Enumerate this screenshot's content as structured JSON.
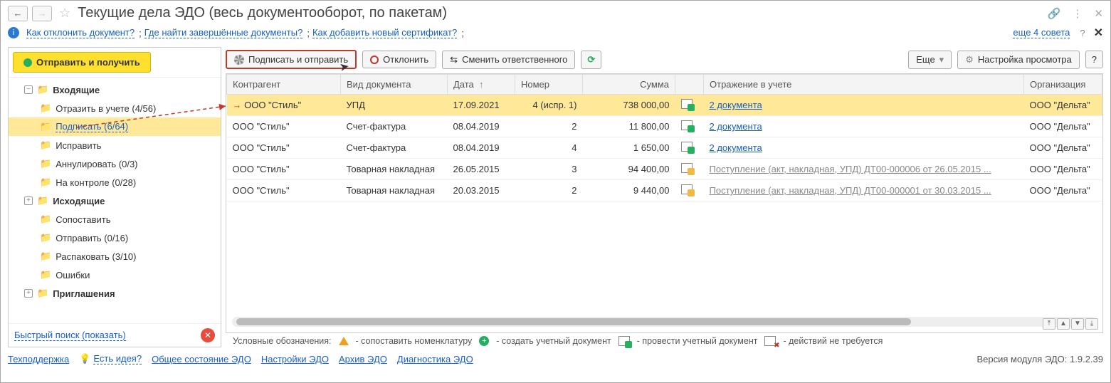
{
  "title": "Текущие дела ЭДО (весь документооборот, по пакетам)",
  "tips": {
    "q1": "Как отклонить документ?",
    "q2": "Где найти завершённые документы?",
    "q3": "Как добавить новый сертификат?",
    "more": "еще 4 совета"
  },
  "sidebar": {
    "main_action": "Отправить и получить",
    "items": [
      {
        "label": "Входящие",
        "level": 1,
        "expander": "−",
        "bold": true
      },
      {
        "label": "Отразить в учете (4/56)",
        "level": 2
      },
      {
        "label": "Подписать (6/64)",
        "level": 2,
        "selected": true
      },
      {
        "label": "Исправить",
        "level": 2
      },
      {
        "label": "Аннулировать (0/3)",
        "level": 2
      },
      {
        "label": "На контроле (0/28)",
        "level": 2
      },
      {
        "label": "Исходящие",
        "level": 1,
        "expander": "+",
        "bold": true
      },
      {
        "label": "Сопоставить",
        "level": 2
      },
      {
        "label": "Отправить (0/16)",
        "level": 2
      },
      {
        "label": "Распаковать (3/10)",
        "level": 2
      },
      {
        "label": "Ошибки",
        "level": 2
      },
      {
        "label": "Приглашения",
        "level": 1,
        "expander": "+",
        "bold": true
      }
    ],
    "quick_search": "Быстрый поиск (показать)"
  },
  "toolbar": {
    "sign_send": "Подписать и отправить",
    "reject": "Отклонить",
    "reassign": "Сменить ответственного",
    "more": "Еще",
    "view_settings": "Настройка просмотра"
  },
  "columns": {
    "counterparty": "Контрагент",
    "doctype": "Вид документа",
    "date": "Дата",
    "number": "Номер",
    "sum": "Сумма",
    "reflection": "Отражение в учете",
    "org": "Организация"
  },
  "rows": [
    {
      "cp": "ООО \"Стиль\"",
      "doctype": "УПД",
      "date": "17.09.2021",
      "number": "4 (испр. 1)",
      "sum": "738 000,00",
      "status": "green",
      "ref": "2 документа",
      "ref_muted": false,
      "org": "ООО \"Дельта\"",
      "sel": true,
      "arrow": true
    },
    {
      "cp": "ООО \"Стиль\"",
      "doctype": "Счет-фактура",
      "date": "08.04.2019",
      "number": "2",
      "sum": "11 800,00",
      "status": "green",
      "ref": "2 документа",
      "ref_muted": false,
      "org": "ООО \"Дельта\""
    },
    {
      "cp": "ООО \"Стиль\"",
      "doctype": "Счет-фактура",
      "date": "08.04.2019",
      "number": "4",
      "sum": "1 650,00",
      "status": "green",
      "ref": "2 документа",
      "ref_muted": false,
      "org": "ООО \"Дельта\""
    },
    {
      "cp": "ООО \"Стиль\"",
      "doctype": "Товарная накладная",
      "date": "26.05.2015",
      "number": "3",
      "sum": "94 400,00",
      "status": "yellow",
      "ref": "Поступление (акт, накладная, УПД) ДТ00-000006 от 26.05.2015 ...",
      "ref_muted": true,
      "org": "ООО \"Дельта\""
    },
    {
      "cp": "ООО \"Стиль\"",
      "doctype": "Товарная накладная",
      "date": "20.03.2015",
      "number": "2",
      "sum": "9 440,00",
      "status": "yellow",
      "ref": "Поступление (акт, накладная, УПД) ДТ00-000001 от 30.03.2015 ...",
      "ref_muted": true,
      "org": "ООО \"Дельта\""
    }
  ],
  "legend": {
    "title": "Условные обозначения:",
    "i1": "- сопоставить номенклатуру",
    "i2": "- создать учетный документ",
    "i3": "- провести учетный документ",
    "i4": "- действий не требуется"
  },
  "footer": {
    "support": "Техподдержка",
    "idea": "Есть идея?",
    "l1": "Общее состояние ЭДО",
    "l2": "Настройки ЭДО",
    "l3": "Архив ЭДО",
    "l4": "Диагностика ЭДО",
    "version": "Версия модуля ЭДО: 1.9.2.39"
  }
}
